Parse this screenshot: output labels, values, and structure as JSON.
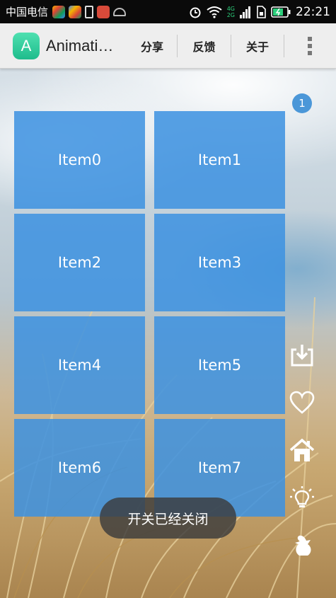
{
  "status_bar": {
    "carrier": "中国电信",
    "network_label_top": "4G",
    "network_label_bottom": "2G",
    "time": "22:21"
  },
  "app_bar": {
    "logo_letter": "A",
    "title": "Animati…",
    "menu": [
      "分享",
      "反馈",
      "关于"
    ]
  },
  "grid": {
    "items": [
      "Item0",
      "Item1",
      "Item2",
      "Item3",
      "Item4",
      "Item5",
      "Item6",
      "Item7"
    ],
    "tile_color": "#3c91e1"
  },
  "badge": {
    "count": "1"
  },
  "side_icons": [
    "download-icon",
    "heart-icon",
    "home-icon",
    "lightbulb-icon",
    "bird-icon"
  ],
  "toast": {
    "message": "开关已经关闭"
  }
}
